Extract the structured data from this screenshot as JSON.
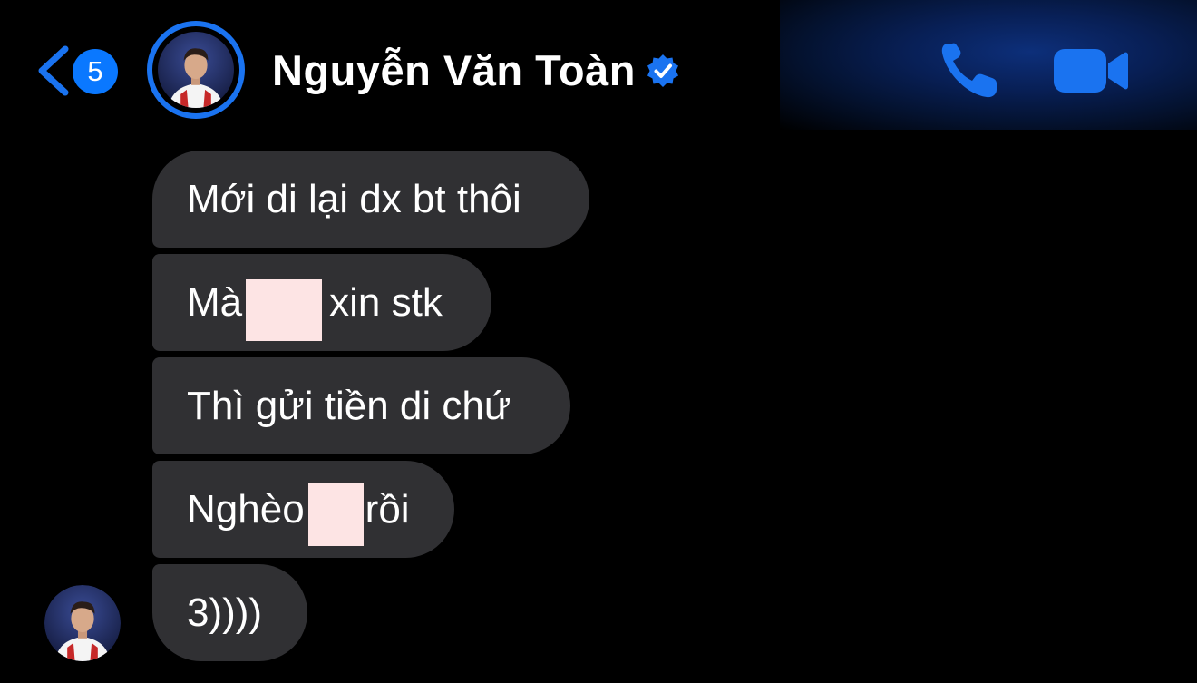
{
  "header": {
    "unread_count": "5",
    "contact_name": "Nguyễn Văn Toàn",
    "verified": true,
    "icons": [
      "back-chevron-icon",
      "verified-badge-icon",
      "phone-icon",
      "video-camera-icon"
    ]
  },
  "messages": [
    {
      "text": "Mới di lại dx bt thôi"
    },
    {
      "before": "Mà",
      "after": "xin stk",
      "redacted": true
    },
    {
      "text": "Thì gửi tiền di chứ"
    },
    {
      "before": "Nghèo",
      "after": "rồi",
      "redacted": true
    },
    {
      "text": "3))))"
    }
  ],
  "colors": {
    "accent": "#0a78ff",
    "bubble": "#303033",
    "background": "#000000",
    "redaction": "#fde4e4"
  }
}
